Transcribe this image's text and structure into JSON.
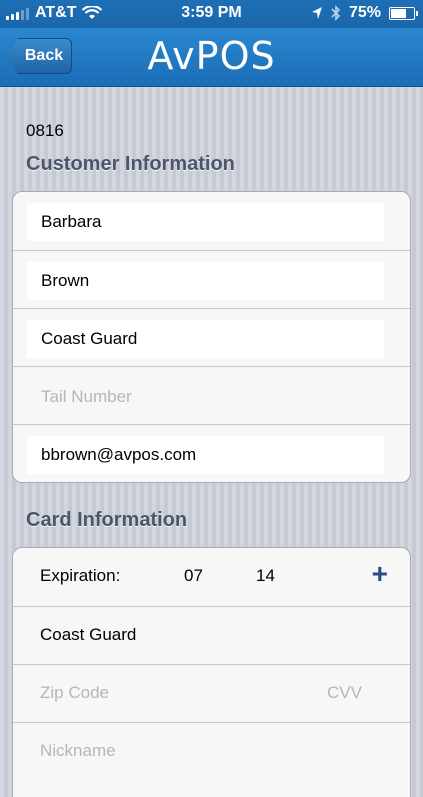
{
  "status_bar": {
    "carrier": "AT&T",
    "time": "3:59 PM",
    "battery": "75%",
    "battery_level": 0.75,
    "icons": [
      "signal-icon",
      "wifi-icon",
      "location-icon",
      "bluetooth-icon",
      "battery-icon"
    ]
  },
  "nav": {
    "back_label": "Back",
    "logo_text": "AvPOS"
  },
  "record_number": "0816",
  "customer": {
    "title": "Customer Information",
    "first_name": "Barbara",
    "last_name": "Brown",
    "organization": "Coast Guard",
    "tail_number_placeholder": "Tail Number",
    "email": "bbrown@avpos.com"
  },
  "card": {
    "title": "Card Information",
    "expiration_label": "Expiration:",
    "exp_month": "07",
    "exp_year": "14",
    "add_symbol": "+",
    "name_on_card": "Coast Guard",
    "zip_placeholder": "Zip Code",
    "cvv_placeholder": "CVV",
    "nickname_placeholder": "Nickname"
  },
  "colors": {
    "nav_blue": "#1f74bd",
    "section_title": "#4c566a",
    "plus_blue": "#2b4d87"
  }
}
